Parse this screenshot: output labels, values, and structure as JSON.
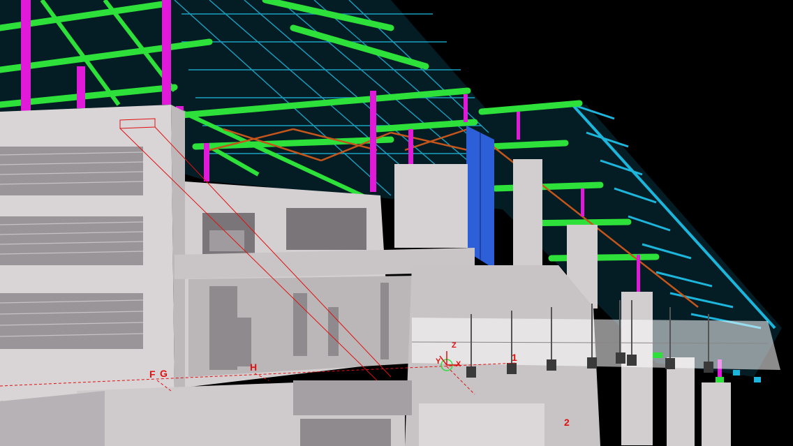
{
  "viewport": {
    "background": "#000000",
    "colors": {
      "concrete": "#d9d4d6",
      "concrete_dark": "#a7a2a5",
      "steel_green": "#2ee03a",
      "steel_cyan": "#19b6d8",
      "column_magenta": "#e01ad8",
      "brace_orange": "#c4561b",
      "panel_blue": "#2d5fd8",
      "grid_red": "#e01010"
    }
  },
  "grid_labels": {
    "f": "F",
    "g": "G",
    "h": "H",
    "one": "1",
    "two": "2"
  },
  "axis_triad": {
    "z": "Z",
    "y": "Y",
    "x": "X"
  }
}
